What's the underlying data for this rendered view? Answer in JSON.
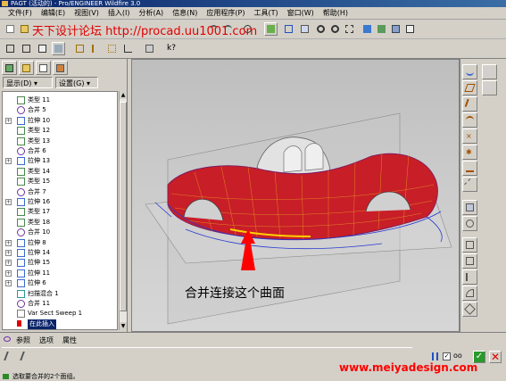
{
  "window": {
    "title": "PAGT (活动的) - Pro/ENGINEER Wildfire 3.0"
  },
  "menu": [
    "文件(F)",
    "编辑(E)",
    "视图(V)",
    "插入(I)",
    "分析(A)",
    "信息(N)",
    "应用程序(P)",
    "工具(T)",
    "窗口(W)",
    "帮助(H)"
  ],
  "watermark": "天下设计论坛 http://procad.uu1001.com",
  "model_tree": {
    "tabs_labels": {
      "show": "显示(D) ▾",
      "settings": "设置(G) ▾"
    },
    "items": [
      {
        "label": "类型 11",
        "expandable": false,
        "icon": "surface-icon"
      },
      {
        "label": "合并 5",
        "expandable": false,
        "icon": "merge-icon"
      },
      {
        "label": "拉伸 10",
        "expandable": true,
        "icon": "extrude-icon"
      },
      {
        "label": "类型 12",
        "expandable": false,
        "icon": "surface-icon"
      },
      {
        "label": "类型 13",
        "expandable": false,
        "icon": "surface-icon"
      },
      {
        "label": "合并 6",
        "expandable": false,
        "icon": "merge-icon"
      },
      {
        "label": "拉伸 13",
        "expandable": true,
        "icon": "extrude-icon"
      },
      {
        "label": "类型 14",
        "expandable": false,
        "icon": "surface-icon"
      },
      {
        "label": "类型 15",
        "expandable": false,
        "icon": "surface-icon"
      },
      {
        "label": "合并 7",
        "expandable": false,
        "icon": "merge-icon"
      },
      {
        "label": "拉伸 16",
        "expandable": true,
        "icon": "extrude-icon"
      },
      {
        "label": "类型 17",
        "expandable": false,
        "icon": "surface-icon"
      },
      {
        "label": "类型 18",
        "expandable": false,
        "icon": "surface-icon"
      },
      {
        "label": "合并 10",
        "expandable": false,
        "icon": "merge-icon"
      },
      {
        "label": "拉伸 8",
        "expandable": true,
        "icon": "extrude-icon"
      },
      {
        "label": "拉伸 14",
        "expandable": true,
        "icon": "extrude-icon"
      },
      {
        "label": "拉伸 15",
        "expandable": true,
        "icon": "extrude-icon"
      },
      {
        "label": "拉伸 11",
        "expandable": true,
        "icon": "extrude-icon"
      },
      {
        "label": "拉伸 6",
        "expandable": true,
        "icon": "extrude-icon"
      },
      {
        "label": "扫描混合 1",
        "expandable": false,
        "icon": "sweep-blend-icon"
      },
      {
        "label": "合并 11",
        "expandable": false,
        "icon": "merge-icon"
      },
      {
        "label": "Var Sect Sweep 1",
        "expandable": false,
        "icon": "var-sweep-icon"
      },
      {
        "label": "在此插入",
        "expandable": false,
        "icon": "insert-here-icon",
        "selected": true
      }
    ]
  },
  "viewport": {
    "annotation": "合并连接这个曲面",
    "annotation_color": "#000000",
    "arrow_color": "#ff0000"
  },
  "dashboard": {
    "tabs": [
      "参照",
      "选项",
      "属性"
    ],
    "website": "www.meiyadesign.com",
    "status": "选取要合并的2个面组。"
  },
  "colors": {
    "accent_red": "#ff0000",
    "title_blue": "#0a246a",
    "surface_red": "#c81e28"
  }
}
